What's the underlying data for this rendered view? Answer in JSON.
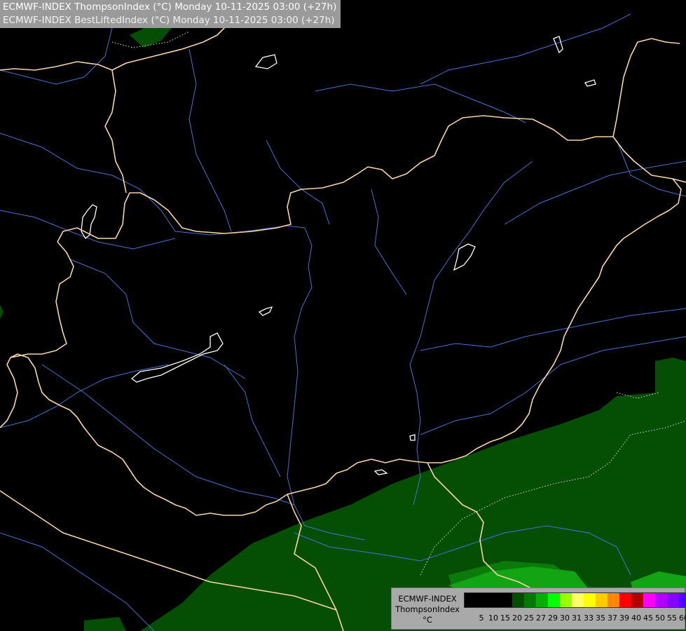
{
  "title": {
    "line1": "ECMWF-INDEX ThompsonIndex (°C) Monday 10-11-2025 03:00 (+27h)",
    "line2": "ECMWF-INDEX BestLiftedIndex (°C) Monday 10-11-2025 03:00 (+27h)"
  },
  "legend": {
    "label_line1": "ECMWF-INDEX",
    "label_line2": "ThompsonIndex",
    "label_line3": "°C",
    "colors": [
      "#000000",
      "#000000",
      "#000000",
      "#000000",
      "#004d00",
      "#007a00",
      "#00b000",
      "#00ff00",
      "#99ff00",
      "#ffff66",
      "#ffff00",
      "#ffcc00",
      "#ff8800",
      "#ff0000",
      "#b00000",
      "#ff00ff",
      "#b400ff",
      "#8800ff",
      "#5000ff",
      "#0000ff"
    ],
    "ticks": [
      "5",
      "10",
      "15",
      "20",
      "25",
      "27",
      "29",
      "30",
      "31",
      "33",
      "35",
      "37",
      "39",
      "40",
      "45",
      "50",
      "55",
      "60"
    ]
  },
  "map": {
    "region": "Hungary and surroundings",
    "colors": {
      "background": "#000000",
      "border": "#f5d5a8",
      "river": "#4a6fd0",
      "lake": "#ffffff",
      "green_dark": "#054f05",
      "green_mid": "#0a7a0a",
      "green_bright": "#12a412",
      "contour": "#dddddd"
    }
  }
}
